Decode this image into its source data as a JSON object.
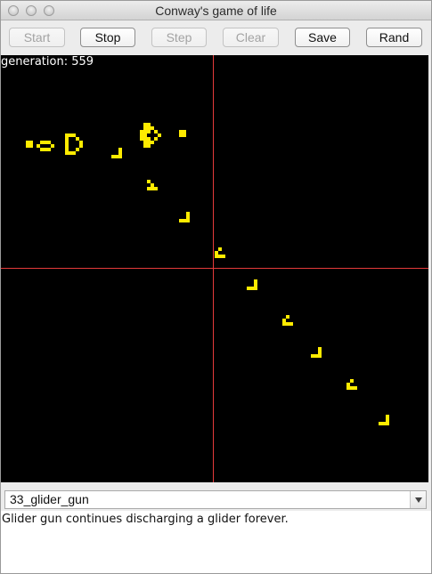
{
  "window": {
    "title": "Conway's game of life"
  },
  "toolbar": {
    "start_label": "Start",
    "stop_label": "Stop",
    "step_label": "Step",
    "clear_label": "Clear",
    "save_label": "Save",
    "rand_label": "Rand"
  },
  "board": {
    "generation_text": "generation: 559",
    "cell_color": "#ffeb00",
    "background_color": "#000000",
    "axis_color": "#e53b3b"
  },
  "pattern_select": {
    "selected": "33_glider_gun"
  },
  "description": {
    "text": "Glider gun continues discharging a glider forever."
  }
}
